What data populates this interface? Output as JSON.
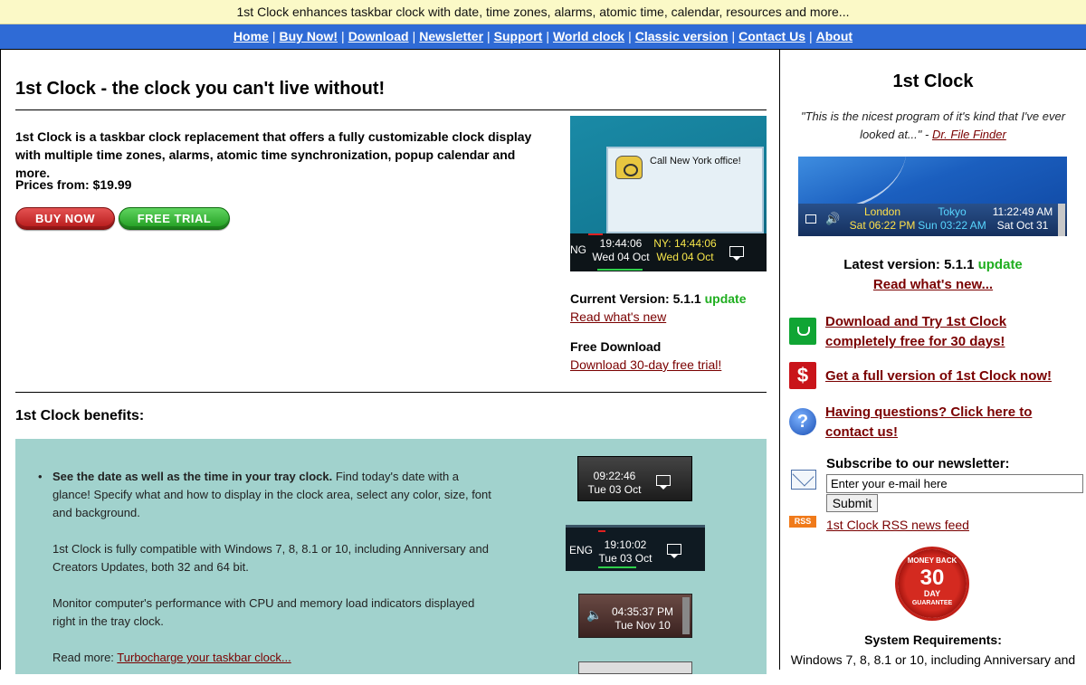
{
  "banner": "1st Clock enhances taskbar clock with date, time zones, alarms, atomic time, calendar, resources and more...",
  "nav": [
    "Home",
    "Buy Now!",
    "Download",
    "Newsletter",
    "Support",
    "World clock",
    "Classic version",
    "Contact Us",
    "About"
  ],
  "main": {
    "title": "1st Clock - the clock you can't live without!",
    "intro": "1st Clock is a taskbar clock replacement that offers a fully customizable clock display with multiple time zones, alarms, atomic time synchronization, popup calendar and more.",
    "prices": "Prices from: $19.99",
    "buy_label": "BUY NOW",
    "trial_label": "FREE TRIAL",
    "screenshot": {
      "alarm_msg": "Call New York office!",
      "lang": "NG",
      "time1": "19:44:06",
      "date1": "Wed 04 Oct",
      "time2": "NY: 14:44:06",
      "date2": "Wed 04 Oct"
    },
    "current_version_label": "Current Version: 5.1.1",
    "update_label": "update",
    "read_whats_new": "Read what's new",
    "free_download_label": "Free Download",
    "download_link": "Download 30-day free trial!",
    "benefits_title": "1st Clock benefits:",
    "benefit_bold": "See the date as well as the time in your tray clock.",
    "benefit_text": " Find today's date with a glance! Specify what and how to display in the clock area, select any color, size, font and background.",
    "benefit_p2": "1st Clock is fully compatible with Windows 7, 8, 8.1 or 10, including Anniversary and Creators Updates, both 32 and 64 bit.",
    "benefit_p3": "Monitor computer's performance with CPU and memory load indicators displayed right in the tray clock.",
    "read_more_label": "Read more: ",
    "read_more_link": "Turbocharge your taskbar clock...",
    "mini1": {
      "time": "09:22:46",
      "date": "Tue 03 Oct"
    },
    "mini2": {
      "lang": "ENG",
      "time": "19:10:02",
      "date": "Tue 03 Oct"
    },
    "mini3": {
      "time": "04:35:37 PM",
      "date": "Tue Nov 10"
    }
  },
  "side": {
    "title": "1st Clock",
    "quote": "\"This is the nicest program of it's kind that I've ever looked at...\" - ",
    "quote_author": "Dr. File Finder",
    "shot": {
      "c1_name": "London",
      "c1_time": "Sat 06:22 PM",
      "c2_name": "Tokyo",
      "c2_time": "Sun 03:22 AM",
      "c3_name": "11:22:49 AM",
      "c3_time": "Sat Oct 31"
    },
    "latest_version": "Latest version: 5.1.1",
    "update_label": "update",
    "read_whats_new": "Read what's new...",
    "action_download": "Download and Try 1st Clock completely free for 30 days!",
    "action_buy": "Get a full version of 1st Clock now!",
    "action_questions": "Having questions? Click here to contact us!",
    "buy_icon_glyph": "$",
    "question_icon_glyph": "?",
    "newsletter_label": "Subscribe to our newsletter:",
    "email_value": "Enter your e-mail here",
    "submit_label": "Submit",
    "rss_badge": "RSS",
    "rss_link": "1st Clock RSS news feed",
    "seal": {
      "top": "MONEY BACK",
      "num": "30",
      "day": "DAY",
      "bottom": "GUARANTEE"
    },
    "sysreq_title": "System Requirements:",
    "sysreq_text": "Windows 7, 8, 8.1 or 10, including Anniversary and"
  }
}
